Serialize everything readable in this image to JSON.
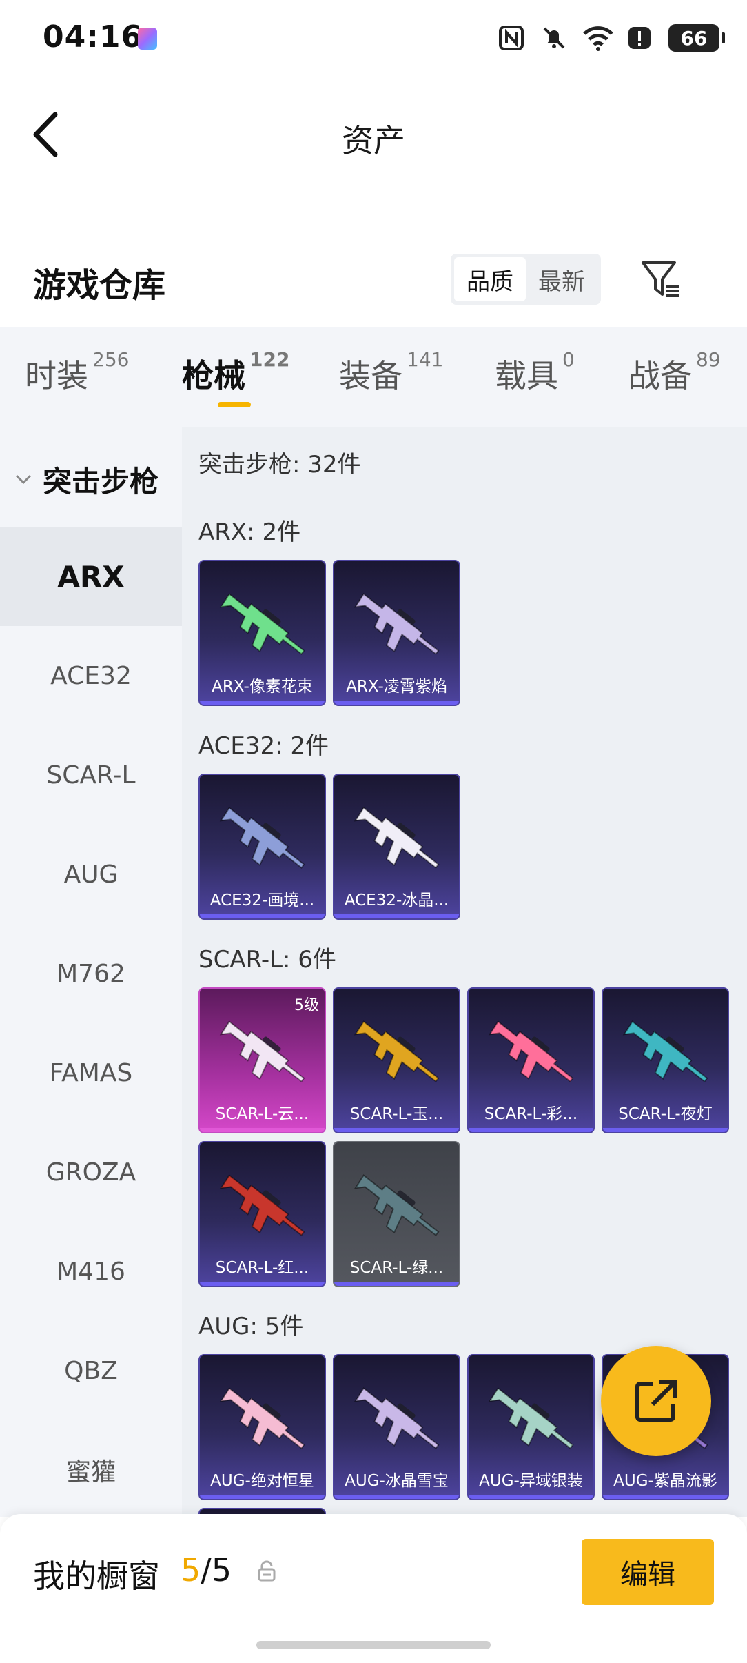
{
  "status_bar": {
    "time": "04:16",
    "battery": "66"
  },
  "header": {
    "title": "资产"
  },
  "warehouse": {
    "title": "游戏仓库",
    "sort_options": [
      "品质",
      "最新"
    ],
    "active_sort": "品质"
  },
  "tabs": [
    {
      "label": "时装",
      "count": "256"
    },
    {
      "label": "枪械",
      "count": "122",
      "active": true
    },
    {
      "label": "装备",
      "count": "141"
    },
    {
      "label": "载具",
      "count": "0"
    },
    {
      "label": "战备",
      "count": "89"
    }
  ],
  "sidebar": {
    "group": "突击步枪",
    "items": [
      "ARX",
      "ACE32",
      "SCAR-L",
      "AUG",
      "M762",
      "FAMAS",
      "GROZA",
      "M416",
      "QBZ",
      "蜜獾"
    ],
    "active": "ARX"
  },
  "content": {
    "category_total": "突击步枪: 32件",
    "sections": [
      {
        "label": "ARX: 2件",
        "items": [
          {
            "name": "ARX-像素花束",
            "gun_color": "#6fe08c"
          },
          {
            "name": "ARX-凌霄紫焰",
            "gun_color": "#c5b6e8"
          }
        ]
      },
      {
        "label": "ACE32: 2件",
        "items": [
          {
            "name": "ACE32-画境...",
            "gun_color": "#8d9ed8"
          },
          {
            "name": "ACE32-冰晶...",
            "gun_color": "#f0eef7"
          }
        ]
      },
      {
        "label": "SCAR-L: 6件",
        "items": [
          {
            "name": "SCAR-L-云...",
            "gun_color": "#f2e6f4",
            "level": "5级",
            "style": "pink"
          },
          {
            "name": "SCAR-L-玉...",
            "gun_color": "#e0a520"
          },
          {
            "name": "SCAR-L-彩...",
            "gun_color": "#ff6f9a"
          },
          {
            "name": "SCAR-L-夜灯",
            "gun_color": "#3fb7c2"
          },
          {
            "name": "SCAR-L-红...",
            "gun_color": "#c8362c"
          },
          {
            "name": "SCAR-L-绿...",
            "gun_color": "#5e7e86",
            "style": "grey"
          }
        ]
      },
      {
        "label": "AUG: 5件",
        "items": [
          {
            "name": "AUG-绝对恒星",
            "gun_color": "#f5bcd3"
          },
          {
            "name": "AUG-冰晶雪宝",
            "gun_color": "#c9b8e8"
          },
          {
            "name": "AUG-异域银装",
            "gun_color": "#a6d3c6"
          },
          {
            "name": "AUG-紫晶流影",
            "gun_color": "#9a7bd8"
          }
        ]
      }
    ]
  },
  "bottom_bar": {
    "label": "我的橱窗",
    "count_current": "5",
    "count_total": "/5",
    "edit_label": "编辑"
  },
  "colors": {
    "accent": "#f8ba1c",
    "card_bar": "#6b5ef0",
    "card_pink": "#d548c9"
  }
}
